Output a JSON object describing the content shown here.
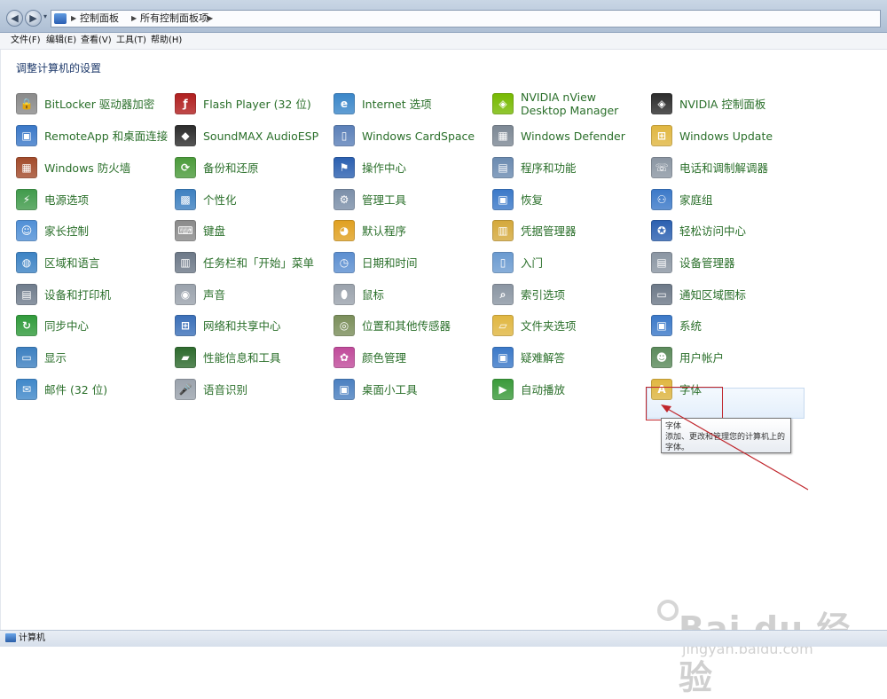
{
  "addressbar": {
    "crumbs": [
      "控制面板",
      "所有控制面板项"
    ]
  },
  "menu": [
    "文件(F)",
    "编辑(E)",
    "查看(V)",
    "工具(T)",
    "帮助(H)"
  ],
  "heading": "调整计算机的设置",
  "columns": [
    [
      {
        "label": "BitLocker 驱动器加密",
        "icon": "bitlocker-icon",
        "color": "#8a8a8a",
        "glyph": "🔒"
      },
      {
        "label": "RemoteApp 和桌面连接",
        "icon": "remoteapp-icon",
        "color": "#3a78c8",
        "glyph": "▣"
      },
      {
        "label": "Windows 防火墙",
        "icon": "firewall-icon",
        "color": "#a24a2a",
        "glyph": "▦"
      },
      {
        "label": "电源选项",
        "icon": "power-icon",
        "color": "#3f9a4a",
        "glyph": "⚡"
      },
      {
        "label": "家长控制",
        "icon": "parental-icon",
        "color": "#4f8fd6",
        "glyph": "☺"
      },
      {
        "label": "区域和语言",
        "icon": "region-icon",
        "color": "#3b82c4",
        "glyph": "◍"
      },
      {
        "label": "设备和打印机",
        "icon": "printer-icon",
        "color": "#6f7c8c",
        "glyph": "▤"
      },
      {
        "label": "同步中心",
        "icon": "sync-icon",
        "color": "#2f9a3a",
        "glyph": "↻"
      },
      {
        "label": "显示",
        "icon": "display-icon",
        "color": "#3c7fc0",
        "glyph": "▭"
      },
      {
        "label": "邮件 (32 位)",
        "icon": "mail-icon",
        "color": "#3f87c9",
        "glyph": "✉"
      }
    ],
    [
      {
        "label": "Flash Player (32 位)",
        "icon": "flash-icon",
        "color": "#b01e1e",
        "glyph": "ƒ"
      },
      {
        "label": "SoundMAX AudioESP",
        "icon": "soundmax-icon",
        "color": "#2b2b2b",
        "glyph": "◆"
      },
      {
        "label": "备份和还原",
        "icon": "backup-icon",
        "color": "#4a9a3a",
        "glyph": "⟳"
      },
      {
        "label": "个性化",
        "icon": "personalize-icon",
        "color": "#3c7fc0",
        "glyph": "▩"
      },
      {
        "label": "键盘",
        "icon": "keyboard-icon",
        "color": "#8a8a8a",
        "glyph": "⌨"
      },
      {
        "label": "任务栏和「开始」菜单",
        "icon": "taskbar-icon",
        "color": "#6c7887",
        "glyph": "▥"
      },
      {
        "label": "声音",
        "icon": "sound-icon",
        "color": "#9aa2ac",
        "glyph": "◉"
      },
      {
        "label": "网络和共享中心",
        "icon": "network-icon",
        "color": "#3a6fb8",
        "glyph": "⊞"
      },
      {
        "label": "性能信息和工具",
        "icon": "performance-icon",
        "color": "#2d6a2d",
        "glyph": "▰"
      },
      {
        "label": "语音识别",
        "icon": "speech-icon",
        "color": "#9aa2ac",
        "glyph": "🎤"
      }
    ],
    [
      {
        "label": "Internet 选项",
        "icon": "internet-icon",
        "color": "#3a86c9",
        "glyph": "e"
      },
      {
        "label": "Windows CardSpace",
        "icon": "cardspace-icon",
        "color": "#5a7fb8",
        "glyph": "▯"
      },
      {
        "label": "操作中心",
        "icon": "action-center-icon",
        "color": "#2a5fb0",
        "glyph": "⚑"
      },
      {
        "label": "管理工具",
        "icon": "admin-tools-icon",
        "color": "#7a8ea8",
        "glyph": "⚙"
      },
      {
        "label": "默认程序",
        "icon": "default-programs-icon",
        "color": "#e0a020",
        "glyph": "◕"
      },
      {
        "label": "日期和时间",
        "icon": "datetime-icon",
        "color": "#5b8ed0",
        "glyph": "◷"
      },
      {
        "label": "鼠标",
        "icon": "mouse-icon",
        "color": "#9aa2ac",
        "glyph": "⬮"
      },
      {
        "label": "位置和其他传感器",
        "icon": "sensor-icon",
        "color": "#7a8e5a",
        "glyph": "◎"
      },
      {
        "label": "颜色管理",
        "icon": "color-mgmt-icon",
        "color": "#c04a9a",
        "glyph": "✿"
      },
      {
        "label": "桌面小工具",
        "icon": "gadgets-icon",
        "color": "#4a7fc0",
        "glyph": "▣"
      }
    ],
    [
      {
        "label": "NVIDIA nView Desktop Manager",
        "icon": "nvidia-nview-icon",
        "color": "#76b900",
        "glyph": "◈"
      },
      {
        "label": "Windows Defender",
        "icon": "defender-icon",
        "color": "#7c8794",
        "glyph": "▦"
      },
      {
        "label": "程序和功能",
        "icon": "programs-icon",
        "color": "#6a8ab0",
        "glyph": "▤"
      },
      {
        "label": "恢复",
        "icon": "recovery-icon",
        "color": "#3a78c8",
        "glyph": "▣"
      },
      {
        "label": "凭据管理器",
        "icon": "credential-icon",
        "color": "#d4a83a",
        "glyph": "▥"
      },
      {
        "label": "入门",
        "icon": "getting-started-icon",
        "color": "#6a9ad0",
        "glyph": "▯"
      },
      {
        "label": "索引选项",
        "icon": "indexing-icon",
        "color": "#8a95a2",
        "glyph": "⌕"
      },
      {
        "label": "文件夹选项",
        "icon": "folder-options-icon",
        "color": "#e0b640",
        "glyph": "▱"
      },
      {
        "label": "疑难解答",
        "icon": "troubleshoot-icon",
        "color": "#3a78c8",
        "glyph": "▣"
      },
      {
        "label": "自动播放",
        "icon": "autoplay-icon",
        "color": "#3a9a3a",
        "glyph": "▶"
      }
    ],
    [
      {
        "label": "NVIDIA 控制面板",
        "icon": "nvidia-panel-icon",
        "color": "#2b2b2b",
        "glyph": "◈"
      },
      {
        "label": "Windows Update",
        "icon": "windows-update-icon",
        "color": "#e0b640",
        "glyph": "⊞"
      },
      {
        "label": "电话和调制解调器",
        "icon": "phone-modem-icon",
        "color": "#8a95a2",
        "glyph": "☏"
      },
      {
        "label": "家庭组",
        "icon": "homegroup-icon",
        "color": "#3a78c8",
        "glyph": "⚇"
      },
      {
        "label": "轻松访问中心",
        "icon": "ease-access-icon",
        "color": "#2a5fb0",
        "glyph": "✪"
      },
      {
        "label": "设备管理器",
        "icon": "device-manager-icon",
        "color": "#8a95a2",
        "glyph": "▤"
      },
      {
        "label": "通知区域图标",
        "icon": "notification-icon",
        "color": "#6c7887",
        "glyph": "▭"
      },
      {
        "label": "系统",
        "icon": "system-icon",
        "color": "#3a78c8",
        "glyph": "▣"
      },
      {
        "label": "用户帐户",
        "icon": "user-accounts-icon",
        "color": "#5a8a5a",
        "glyph": "☻"
      },
      {
        "label": "字体",
        "icon": "fonts-icon",
        "color": "#e0b640",
        "glyph": "A"
      }
    ]
  ],
  "tooltip": {
    "title": "字体",
    "text": "添加、更改和管理您的计算机上的字体。"
  },
  "status": "计算机",
  "watermark": {
    "brand": "Bai du 经验",
    "url": "jingyan.baidu.com"
  }
}
